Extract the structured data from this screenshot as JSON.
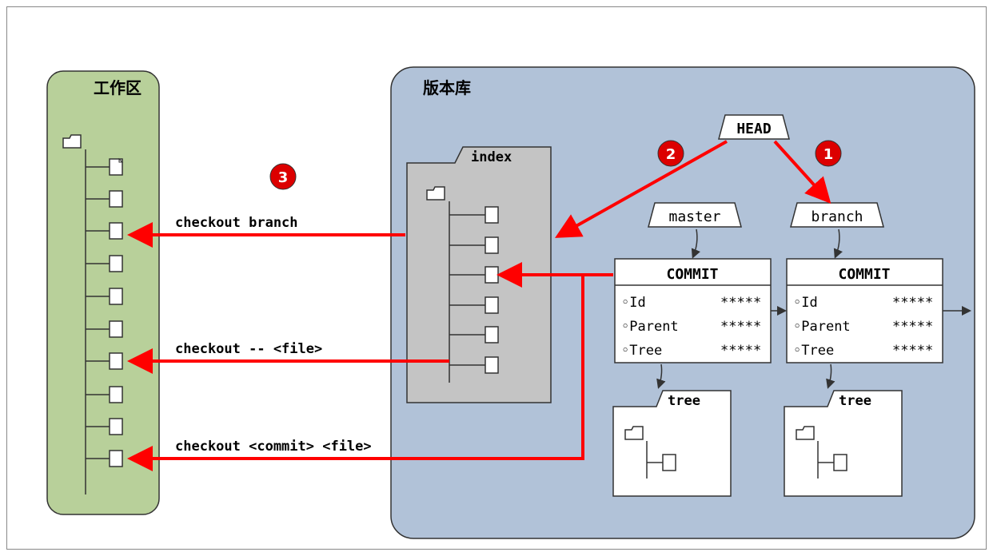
{
  "workingArea": {
    "title": "工作区"
  },
  "repository": {
    "title": "版本库",
    "index": "index",
    "head": "HEAD",
    "branches": {
      "master": "master",
      "branch": "branch"
    },
    "commitBox": {
      "title": "COMMIT",
      "rows": [
        {
          "label": "Id",
          "value": "*****"
        },
        {
          "label": "Parent",
          "value": "*****"
        },
        {
          "label": "Tree",
          "value": "*****"
        }
      ]
    },
    "tree": "tree"
  },
  "badges": {
    "one": "1",
    "two": "2",
    "three": "3"
  },
  "labels": {
    "checkoutBranch": "checkout branch",
    "checkoutFile": "checkout -- <file>",
    "checkoutCommitFile": "checkout <commit> <file>"
  }
}
